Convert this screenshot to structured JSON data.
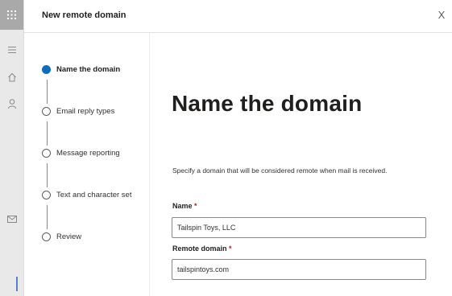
{
  "rail": {
    "icons": [
      "waffle-icon",
      "menu-icon",
      "home-icon",
      "person-icon",
      "mail-icon"
    ]
  },
  "panel": {
    "title": "New remote domain",
    "close_label": "X"
  },
  "steps": [
    {
      "label": "Name the domain",
      "active": true
    },
    {
      "label": "Email reply types",
      "active": false
    },
    {
      "label": "Message reporting",
      "active": false
    },
    {
      "label": "Text and character set",
      "active": false
    },
    {
      "label": "Review",
      "active": false
    }
  ],
  "content": {
    "heading": "Name the domain",
    "description": "Specify a domain that will be considered remote when mail is received.",
    "name_field": {
      "label": "Name",
      "required_mark": "*",
      "value": "Tailspin Toys, LLC"
    },
    "domain_field": {
      "label": "Remote domain",
      "required_mark": "*",
      "value": "tailspintoys.com"
    }
  },
  "colors": {
    "accent": "#0f6cbd",
    "required": "#a4262c",
    "rail": "#e9e9e9"
  }
}
